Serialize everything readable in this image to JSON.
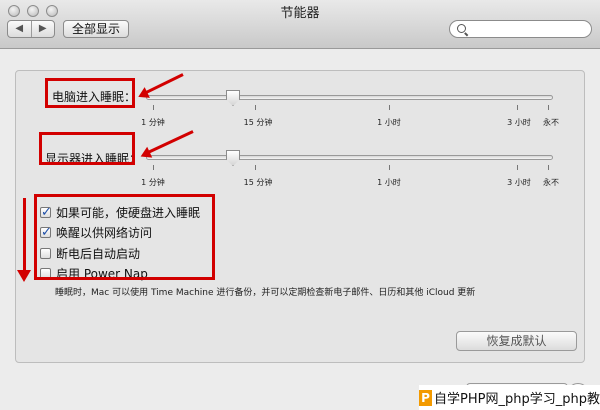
{
  "window": {
    "title": "节能器",
    "show_all": "全部显示",
    "nav_back": "◀",
    "nav_forward": "▶",
    "search_placeholder": ""
  },
  "computer_sleep": {
    "label": "电脑进入睡眠：",
    "value": "15 分钟",
    "ticks": [
      "1 分钟",
      "15 分钟",
      "1 小时",
      "3 小时",
      "永不"
    ]
  },
  "display_sleep": {
    "label": "显示器进入睡眠：",
    "value": "15 分钟",
    "ticks": [
      "1 分钟",
      "15 分钟",
      "1 小时",
      "3 小时",
      "永不"
    ]
  },
  "options": [
    {
      "label": "如果可能，使硬盘进入睡眠",
      "checked": true
    },
    {
      "label": "唤醒以供网络访问",
      "checked": true
    },
    {
      "label": "断电后自动启动",
      "checked": false
    },
    {
      "label": "启用 Power Nap",
      "checked": false
    }
  ],
  "power_nap_note": "睡眠时，Mac 可以使用 Time Machine 进行备份，并可以定期检查新电子邮件、日历和其他 iCloud 更新",
  "restore_defaults": "恢复成默认",
  "watermark": {
    "logo": "P",
    "text": "自学PHP网_php学习_php教"
  },
  "annotation_color": "#d20000"
}
